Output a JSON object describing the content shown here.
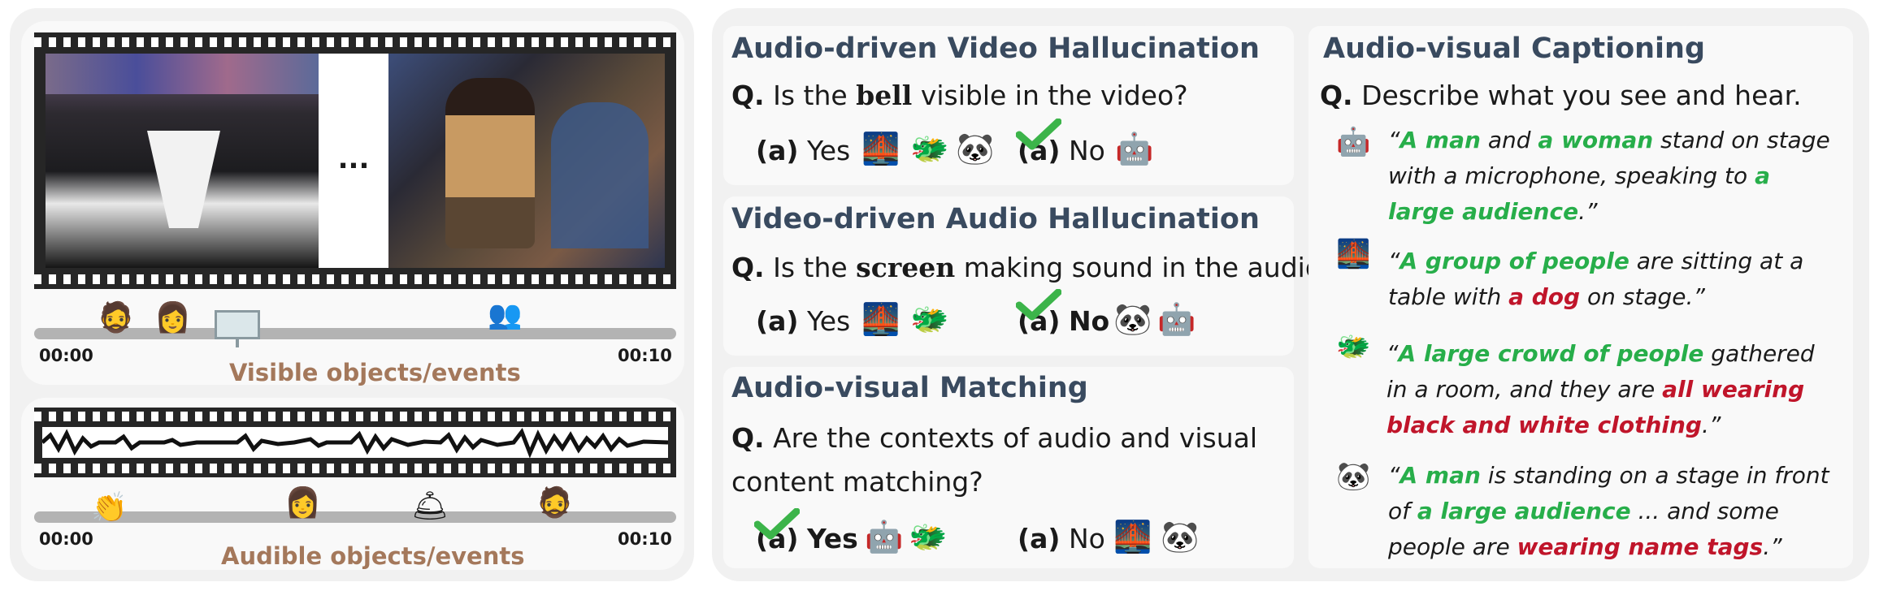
{
  "left": {
    "ellipsis": "...",
    "visual_time_start": "00:00",
    "visual_time_end": "00:10",
    "visual_caption": "Visible objects/events",
    "audio_time_start": "00:00",
    "audio_time_end": "00:10",
    "audio_caption": "Audible objects/events"
  },
  "avvh": {
    "title": "Audio-driven Video Hallucination",
    "q_prefix": "Q.",
    "q_before": "Is the",
    "q_key": "bell",
    "q_after": "visible in the video?",
    "opt1_label": "(a)",
    "opt1_text": "Yes",
    "opt2_label": "(a)",
    "opt2_text": "No"
  },
  "vdah": {
    "title": "Video-driven Audio Hallucination",
    "q_prefix": "Q.",
    "q_before": "Is the",
    "q_key": "screen",
    "q_after": "making sound in the audio?",
    "opt1_label": "(a)",
    "opt1_text": "Yes",
    "opt2_label": "(a)",
    "opt2_text": "No"
  },
  "avm": {
    "title": "Audio-visual Matching",
    "q_prefix": "Q.",
    "q_line1": "Are the contexts of audio and visual",
    "q_line2": "content matching?",
    "opt1_label": "(a)",
    "opt1_text": "Yes",
    "opt2_label": "(a)",
    "opt2_text": "No"
  },
  "cap": {
    "title": "Audio-visual Captioning",
    "q_prefix": "Q.",
    "q_text": "Describe what you see and hear.",
    "c1": {
      "open": "“",
      "a": "A man",
      "b": " and ",
      "c": "a woman",
      "d": " stand on stage with a microphone, speaking to ",
      "e": "a large audience",
      "f": ".”"
    },
    "c2": {
      "open": "“",
      "a": "A group of people",
      "b": " are sitting at a table with ",
      "c": "a dog",
      "d": " on stage.”"
    },
    "c3": {
      "open": "“",
      "a": "A large crowd of people",
      "b": " gathered in a room, and they are ",
      "c": "all wearing black and white clothing",
      "d": ".”"
    },
    "c4": {
      "open": "“",
      "a": "A man",
      "b": " is standing on a stage in front of ",
      "c": "a large audience",
      "d": " ... and some people are ",
      "e": "wearing name tags",
      "f": ".”"
    }
  },
  "colors": {
    "heading": "#394a5f",
    "correct": "#27ae4a",
    "wrong": "#c0152a",
    "caption": "#a4785b",
    "check": "#3cb44a"
  },
  "icons": [
    "person-bearded-icon",
    "person-woman-icon",
    "projector-screen-icon",
    "crowd-icon",
    "clapping-hands-icon",
    "bell-icon",
    "model-bridge-icon",
    "model-dragon-icon",
    "model-panda-icon",
    "model-robot-icon",
    "checkmark-icon"
  ]
}
